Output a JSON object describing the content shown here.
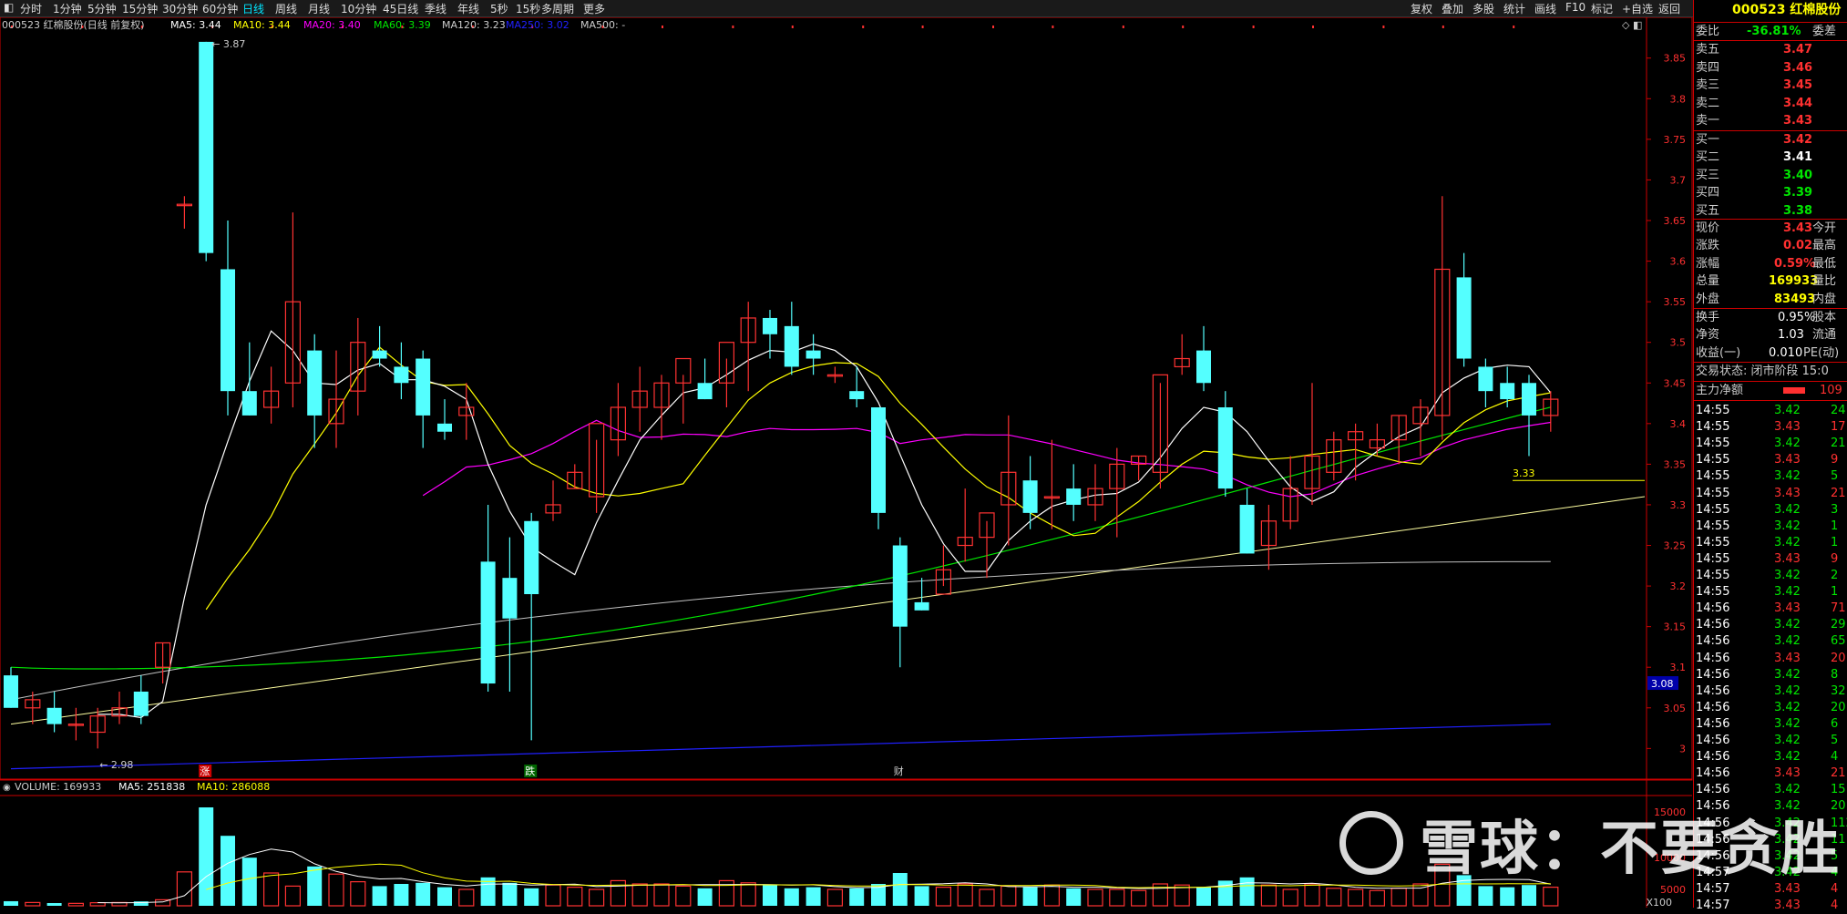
{
  "toolbar": {
    "periods": [
      "分时",
      "1分钟",
      "5分钟",
      "15分钟",
      "30分钟",
      "60分钟",
      "日线",
      "周线",
      "月线",
      "10分钟",
      "45日线",
      "季线",
      "年线",
      "5秒",
      "15秒",
      "多周期",
      "更多"
    ],
    "active_period": "日线",
    "right_buttons": [
      "复权",
      "叠加",
      "多股",
      "统计",
      "画线",
      "F10",
      "标记",
      "+自选",
      "返回"
    ]
  },
  "legend": {
    "title": "000523 红棉股份(日线 前复权)",
    "ma5": "MA5: 3.44",
    "ma10": "MA10: 3.44",
    "ma20": "MA20: 3.40",
    "ma60": "MA60: 3.39",
    "ma120": "MA120: 3.23",
    "ma250": "MA250: 3.02",
    "ma500": "MA500: -"
  },
  "vol_legend": {
    "volume": "VOLUME: 169933",
    "ma5": "MA5: 251838",
    "ma10": "MA10: 286088"
  },
  "annotations": {
    "high": "3.87",
    "low": "2.98",
    "hline": "3.33",
    "current_price_tag": "3.08",
    "marker_zhang": "涨",
    "marker_die": "跌",
    "marker_cai": "财",
    "vol_unit": "X100",
    "vol_tick_15000": "15000",
    "vol_tick_10000": "10000",
    "vol_tick_5000": "5000"
  },
  "colors": {
    "up": "#ff3232",
    "down": "#54ffff",
    "ma5": "#ffffff",
    "ma10": "#ffff00",
    "ma20": "#ff00ff",
    "ma60": "#00e600",
    "ma120": "#c0c0c0",
    "ma250": "#2020ff"
  },
  "panel": {
    "stock_title": "000523 红棉股份",
    "weibi_label": "委比",
    "weibi_value": "-36.81%",
    "weicha_label": "委差",
    "sells": [
      {
        "label": "卖五",
        "price": "3.47"
      },
      {
        "label": "卖四",
        "price": "3.46"
      },
      {
        "label": "卖三",
        "price": "3.45"
      },
      {
        "label": "卖二",
        "price": "3.44"
      },
      {
        "label": "卖一",
        "price": "3.43"
      }
    ],
    "buys": [
      {
        "label": "买一",
        "price": "3.42"
      },
      {
        "label": "买二",
        "price": "3.41"
      },
      {
        "label": "买三",
        "price": "3.40"
      },
      {
        "label": "买四",
        "price": "3.39"
      },
      {
        "label": "买五",
        "price": "3.38"
      }
    ],
    "stats": [
      {
        "l1": "现价",
        "v1": "3.43",
        "l2": "今开"
      },
      {
        "l1": "涨跌",
        "v1": "0.02",
        "l2": "最高"
      },
      {
        "l1": "涨幅",
        "v1": "0.59%",
        "l2": "最低"
      },
      {
        "l1": "总量",
        "v1": "169933",
        "l2": "量比"
      },
      {
        "l1": "外盘",
        "v1": "83493",
        "l2": "内盘"
      }
    ],
    "fund": [
      {
        "l1": "换手",
        "v1": "0.95%",
        "l2": "股本"
      },
      {
        "l1": "净资",
        "v1": "1.03",
        "l2": "流通"
      },
      {
        "l1": "收益(一)",
        "v1": "0.010",
        "l2": "PE(动)"
      }
    ],
    "trade_status": "交易状态: 闭市阶段 15:0",
    "main_flow_label": "主力净额",
    "main_flow_value": "109",
    "ticks": [
      {
        "t": "14:55",
        "p": "3.42",
        "v": "24"
      },
      {
        "t": "14:55",
        "p": "3.43",
        "v": "17"
      },
      {
        "t": "14:55",
        "p": "3.42",
        "v": "21"
      },
      {
        "t": "14:55",
        "p": "3.43",
        "v": "9"
      },
      {
        "t": "14:55",
        "p": "3.42",
        "v": "5"
      },
      {
        "t": "14:55",
        "p": "3.43",
        "v": "21"
      },
      {
        "t": "14:55",
        "p": "3.42",
        "v": "3"
      },
      {
        "t": "14:55",
        "p": "3.42",
        "v": "1"
      },
      {
        "t": "14:55",
        "p": "3.42",
        "v": "1"
      },
      {
        "t": "14:55",
        "p": "3.43",
        "v": "9"
      },
      {
        "t": "14:55",
        "p": "3.42",
        "v": "2"
      },
      {
        "t": "14:55",
        "p": "3.42",
        "v": "1"
      },
      {
        "t": "14:56",
        "p": "3.43",
        "v": "71"
      },
      {
        "t": "14:56",
        "p": "3.42",
        "v": "29"
      },
      {
        "t": "14:56",
        "p": "3.42",
        "v": "65"
      },
      {
        "t": "14:56",
        "p": "3.43",
        "v": "20"
      },
      {
        "t": "14:56",
        "p": "3.42",
        "v": "8"
      },
      {
        "t": "14:56",
        "p": "3.42",
        "v": "32"
      },
      {
        "t": "14:56",
        "p": "3.42",
        "v": "20"
      },
      {
        "t": "14:56",
        "p": "3.42",
        "v": "6"
      },
      {
        "t": "14:56",
        "p": "3.42",
        "v": "5"
      },
      {
        "t": "14:56",
        "p": "3.42",
        "v": "4"
      },
      {
        "t": "14:56",
        "p": "3.43",
        "v": "21"
      },
      {
        "t": "14:56",
        "p": "3.42",
        "v": "15"
      },
      {
        "t": "14:56",
        "p": "3.42",
        "v": "20"
      },
      {
        "t": "14:56",
        "p": "3.42",
        "v": "112"
      },
      {
        "t": "14:56",
        "p": "3.42",
        "v": "11"
      },
      {
        "t": "14:56",
        "p": "3.42",
        "v": "5"
      },
      {
        "t": "14:57",
        "p": "3.42",
        "v": "4"
      },
      {
        "t": "14:57",
        "p": "3.43",
        "v": "4"
      },
      {
        "t": "14:57",
        "p": "3.43",
        "v": "4"
      }
    ]
  },
  "watermark": "雪球：不要贪胜",
  "chart_data": {
    "type": "candlestick",
    "title": "000523 红棉股份(日线 前复权)",
    "ylim": [
      2.96,
      3.88
    ],
    "y_ticks": [
      3.0,
      3.05,
      3.1,
      3.15,
      3.2,
      3.25,
      3.3,
      3.35,
      3.4,
      3.45,
      3.5,
      3.55,
      3.6,
      3.65,
      3.7,
      3.75,
      3.8,
      3.85
    ],
    "candles": [
      [
        3.09,
        3.1,
        3.05,
        3.05
      ],
      [
        3.05,
        3.07,
        3.03,
        3.06
      ],
      [
        3.05,
        3.07,
        3.02,
        3.03
      ],
      [
        3.03,
        3.05,
        3.01,
        3.03
      ],
      [
        3.02,
        3.05,
        3.0,
        3.04
      ],
      [
        3.04,
        3.07,
        3.03,
        3.05
      ],
      [
        3.07,
        3.09,
        3.03,
        3.04
      ],
      [
        3.1,
        3.13,
        3.08,
        3.13
      ],
      [
        3.67,
        3.68,
        3.64,
        3.67
      ],
      [
        3.87,
        3.87,
        3.6,
        3.61
      ],
      [
        3.59,
        3.65,
        3.41,
        3.44
      ],
      [
        3.44,
        3.5,
        3.41,
        3.41
      ],
      [
        3.42,
        3.47,
        3.4,
        3.44
      ],
      [
        3.45,
        3.66,
        3.42,
        3.55
      ],
      [
        3.49,
        3.51,
        3.37,
        3.41
      ],
      [
        3.4,
        3.49,
        3.37,
        3.43
      ],
      [
        3.44,
        3.53,
        3.41,
        3.5
      ],
      [
        3.49,
        3.52,
        3.47,
        3.48
      ],
      [
        3.47,
        3.5,
        3.43,
        3.45
      ],
      [
        3.48,
        3.49,
        3.37,
        3.41
      ],
      [
        3.4,
        3.43,
        3.38,
        3.39
      ],
      [
        3.41,
        3.45,
        3.38,
        3.42
      ],
      [
        3.23,
        3.3,
        3.07,
        3.08
      ],
      [
        3.21,
        3.26,
        3.07,
        3.16
      ],
      [
        3.28,
        3.29,
        3.01,
        3.19
      ],
      [
        3.29,
        3.33,
        3.28,
        3.3
      ],
      [
        3.32,
        3.35,
        3.32,
        3.34
      ],
      [
        3.31,
        3.38,
        3.29,
        3.4
      ],
      [
        3.38,
        3.45,
        3.36,
        3.42
      ],
      [
        3.42,
        3.47,
        3.39,
        3.44
      ],
      [
        3.42,
        3.46,
        3.38,
        3.45
      ],
      [
        3.45,
        3.46,
        3.4,
        3.48
      ],
      [
        3.45,
        3.48,
        3.43,
        3.43
      ],
      [
        3.45,
        3.48,
        3.42,
        3.5
      ],
      [
        3.5,
        3.55,
        3.44,
        3.53
      ],
      [
        3.53,
        3.54,
        3.48,
        3.51
      ],
      [
        3.52,
        3.55,
        3.46,
        3.47
      ],
      [
        3.49,
        3.51,
        3.46,
        3.48
      ],
      [
        3.46,
        3.47,
        3.45,
        3.46
      ],
      [
        3.44,
        3.47,
        3.42,
        3.43
      ],
      [
        3.42,
        3.42,
        3.27,
        3.29
      ],
      [
        3.25,
        3.26,
        3.1,
        3.15
      ],
      [
        3.18,
        3.21,
        3.17,
        3.17
      ],
      [
        3.19,
        3.25,
        3.2,
        3.22
      ],
      [
        3.25,
        3.32,
        3.23,
        3.26
      ],
      [
        3.26,
        3.28,
        3.21,
        3.29
      ],
      [
        3.3,
        3.41,
        3.25,
        3.34
      ],
      [
        3.33,
        3.36,
        3.27,
        3.29
      ],
      [
        3.31,
        3.38,
        3.27,
        3.31
      ],
      [
        3.32,
        3.35,
        3.28,
        3.3
      ],
      [
        3.3,
        3.35,
        3.28,
        3.32
      ],
      [
        3.32,
        3.37,
        3.26,
        3.35
      ],
      [
        3.35,
        3.36,
        3.33,
        3.36
      ],
      [
        3.34,
        3.45,
        3.32,
        3.46
      ],
      [
        3.47,
        3.51,
        3.46,
        3.48
      ],
      [
        3.49,
        3.52,
        3.44,
        3.45
      ],
      [
        3.42,
        3.44,
        3.31,
        3.32
      ],
      [
        3.3,
        3.32,
        3.24,
        3.24
      ],
      [
        3.25,
        3.3,
        3.22,
        3.28
      ],
      [
        3.28,
        3.36,
        3.27,
        3.32
      ],
      [
        3.32,
        3.45,
        3.3,
        3.36
      ],
      [
        3.34,
        3.39,
        3.33,
        3.38
      ],
      [
        3.38,
        3.4,
        3.33,
        3.39
      ],
      [
        3.37,
        3.4,
        3.36,
        3.38
      ],
      [
        3.38,
        3.41,
        3.35,
        3.41
      ],
      [
        3.4,
        3.43,
        3.36,
        3.42
      ],
      [
        3.41,
        3.68,
        3.38,
        3.59
      ],
      [
        3.58,
        3.61,
        3.47,
        3.48
      ],
      [
        3.47,
        3.48,
        3.42,
        3.44
      ],
      [
        3.45,
        3.47,
        3.42,
        3.43
      ],
      [
        3.45,
        3.46,
        3.36,
        3.41
      ],
      [
        3.41,
        3.44,
        3.39,
        3.43
      ]
    ],
    "volume": [
      42,
      30,
      25,
      22,
      28,
      30,
      40,
      55,
      310,
      900,
      640,
      440,
      300,
      180,
      360,
      290,
      220,
      180,
      200,
      210,
      170,
      150,
      260,
      210,
      160,
      190,
      170,
      150,
      230,
      200,
      200,
      180,
      160,
      230,
      210,
      190,
      160,
      170,
      150,
      160,
      200,
      300,
      180,
      170,
      200,
      150,
      180,
      170,
      190,
      160,
      150,
      150,
      140,
      200,
      190,
      170,
      230,
      260,
      190,
      150,
      200,
      160,
      150,
      140,
      160,
      200,
      380,
      280,
      180,
      170,
      190,
      170
    ],
    "vol_ylim": [
      0,
      18000
    ]
  }
}
